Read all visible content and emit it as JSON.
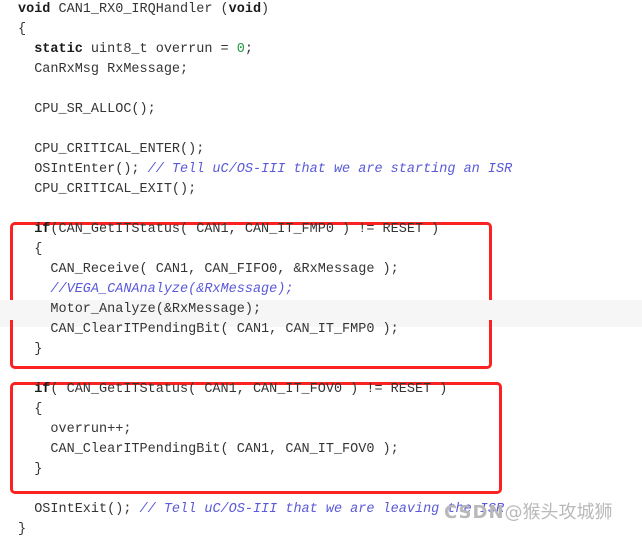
{
  "document": {
    "type": "source-code-screenshot",
    "language": "C",
    "function_name": "CAN1_RX0_IRQHandler"
  },
  "colors": {
    "background": "#ffffff",
    "text": "#353535",
    "keyword": "#1a1a1a",
    "comment": "#5a5ad8",
    "number": "#1f9b3f",
    "annotation_box": "#fb2222",
    "highlight_row": "#f6f6f6",
    "watermark": "#b9b9b9"
  },
  "code": {
    "lines": [
      {
        "id": "line-1",
        "indent": 0,
        "segments": [
          {
            "t": "void",
            "c": "kw"
          },
          {
            "t": " CAN1_RX0_IRQHandler (",
            "c": ""
          },
          {
            "t": "void",
            "c": "kw"
          },
          {
            "t": ")",
            "c": ""
          }
        ]
      },
      {
        "id": "line-2",
        "indent": 0,
        "segments": [
          {
            "t": "{",
            "c": ""
          }
        ]
      },
      {
        "id": "line-3",
        "indent": 1,
        "segments": [
          {
            "t": "static",
            "c": "kw"
          },
          {
            "t": " uint8_t overrun = ",
            "c": ""
          },
          {
            "t": "0",
            "c": "num"
          },
          {
            "t": ";",
            "c": ""
          }
        ]
      },
      {
        "id": "line-4",
        "indent": 1,
        "segments": [
          {
            "t": "CanRxMsg RxMessage;",
            "c": ""
          }
        ]
      },
      {
        "id": "line-5",
        "indent": 0,
        "segments": [
          {
            "t": "",
            "c": ""
          }
        ]
      },
      {
        "id": "line-6",
        "indent": 1,
        "segments": [
          {
            "t": "CPU_SR_ALLOC();",
            "c": ""
          }
        ]
      },
      {
        "id": "line-7",
        "indent": 0,
        "segments": [
          {
            "t": "",
            "c": ""
          }
        ]
      },
      {
        "id": "line-8",
        "indent": 1,
        "segments": [
          {
            "t": "CPU_CRITICAL_ENTER();",
            "c": ""
          }
        ]
      },
      {
        "id": "line-9",
        "indent": 1,
        "segments": [
          {
            "t": "OSIntEnter(); ",
            "c": ""
          },
          {
            "t": "// Tell uC/OS-III that we are starting an ISR",
            "c": "cmt"
          }
        ]
      },
      {
        "id": "line-10",
        "indent": 1,
        "segments": [
          {
            "t": "CPU_CRITICAL_EXIT();",
            "c": ""
          }
        ]
      },
      {
        "id": "line-11",
        "indent": 0,
        "segments": [
          {
            "t": "",
            "c": ""
          }
        ]
      },
      {
        "id": "line-12",
        "indent": 1,
        "segments": [
          {
            "t": "if",
            "c": "kw"
          },
          {
            "t": "(CAN_GetITStatus( CAN1, CAN_IT_FMP0 ) != RESET )",
            "c": ""
          }
        ]
      },
      {
        "id": "line-13",
        "indent": 1,
        "segments": [
          {
            "t": "{",
            "c": ""
          }
        ]
      },
      {
        "id": "line-14",
        "indent": 2,
        "segments": [
          {
            "t": "CAN_Receive( CAN1, CAN_FIFO0, &RxMessage );",
            "c": ""
          }
        ]
      },
      {
        "id": "line-15",
        "indent": 2,
        "segments": [
          {
            "t": "//VEGA_CANAnalyze(&RxMessage);",
            "c": "cmt"
          }
        ]
      },
      {
        "id": "line-16",
        "indent": 2,
        "highlight": true,
        "segments": [
          {
            "t": "Motor_Analyze(&RxMessage);",
            "c": ""
          }
        ]
      },
      {
        "id": "line-17",
        "indent": 2,
        "segments": [
          {
            "t": "CAN_ClearITPendingBit( CAN1, CAN_IT_FMP0 );",
            "c": ""
          }
        ]
      },
      {
        "id": "line-18",
        "indent": 1,
        "segments": [
          {
            "t": "}",
            "c": ""
          }
        ]
      },
      {
        "id": "line-19",
        "indent": 0,
        "segments": [
          {
            "t": "",
            "c": ""
          }
        ]
      },
      {
        "id": "line-20",
        "indent": 1,
        "segments": [
          {
            "t": "if",
            "c": "kw"
          },
          {
            "t": "( CAN_GetITStatus( CAN1, CAN_IT_FOV0 ) != RESET )",
            "c": ""
          }
        ]
      },
      {
        "id": "line-21",
        "indent": 1,
        "segments": [
          {
            "t": "{",
            "c": ""
          }
        ]
      },
      {
        "id": "line-22",
        "indent": 2,
        "segments": [
          {
            "t": "overrun++;",
            "c": ""
          }
        ]
      },
      {
        "id": "line-23",
        "indent": 2,
        "segments": [
          {
            "t": "CAN_ClearITPendingBit( CAN1, CAN_IT_FOV0 );",
            "c": ""
          }
        ]
      },
      {
        "id": "line-24",
        "indent": 1,
        "segments": [
          {
            "t": "}",
            "c": ""
          }
        ]
      },
      {
        "id": "line-25",
        "indent": 0,
        "segments": [
          {
            "t": "",
            "c": ""
          }
        ]
      },
      {
        "id": "line-26",
        "indent": 1,
        "segments": [
          {
            "t": "OSIntExit(); ",
            "c": ""
          },
          {
            "t": "// Tell uC/OS-III that we are leaving the ISR",
            "c": "cmt"
          }
        ]
      },
      {
        "id": "line-27",
        "indent": 0,
        "segments": [
          {
            "t": "}",
            "c": ""
          }
        ]
      }
    ]
  },
  "annotations": {
    "boxes": [
      {
        "id": "redbox-fmp0",
        "label": "CAN_IT_FMP0 receive handler block"
      },
      {
        "id": "redbox-fov0",
        "label": "CAN_IT_FOV0 overrun handler block"
      }
    ]
  },
  "watermark": {
    "brand": "CSDN",
    "separator": "@",
    "author": "猴头攻城狮",
    "full_text": "CSDN @猴头攻城狮"
  }
}
